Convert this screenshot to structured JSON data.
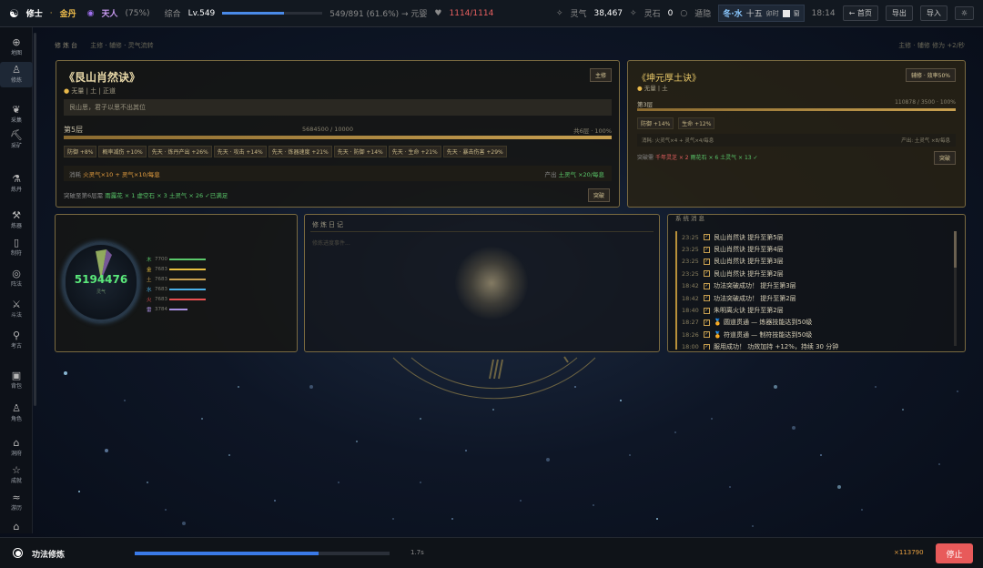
{
  "topbar": {
    "logo_icon": "yin-yang-icon",
    "profession": "修士",
    "realm": "金丹",
    "rank": "天人",
    "rank_pct": "(75%)",
    "level_label": "综合",
    "level": "Lv.549",
    "exp_text": "549/891 (61.6%) → 元婴",
    "exp_fraction": 0.616,
    "hp_icon": "heart-icon",
    "hp": "1114/1114",
    "spirit_qi_label": "灵气",
    "spirit_qi": "38,467",
    "spirit_stone_label": "灵石",
    "spirit_stone": "0",
    "travel_label": "遁隐",
    "season": "冬·水",
    "day": "十五",
    "hour": "卯时",
    "window_label": "窗",
    "time": "18:14",
    "home_btn": "← 首页",
    "export_btn": "导出",
    "import_btn": "导入",
    "settings_icon": "gear-icon"
  },
  "sidebar": [
    {
      "icon": "map-icon",
      "glyph": "⊕",
      "label": "地图"
    },
    {
      "icon": "cultivate-icon",
      "glyph": "♙",
      "label": "修炼"
    },
    {
      "icon": "gather-icon",
      "glyph": "❦",
      "label": "采集"
    },
    {
      "icon": "mine-icon",
      "glyph": "⛏",
      "label": "采矿"
    },
    {
      "icon": "alchemy-icon",
      "glyph": "⚗",
      "label": "炼丹"
    },
    {
      "icon": "forge-icon",
      "glyph": "⚒",
      "label": "炼器"
    },
    {
      "icon": "talisman-icon",
      "glyph": "▯",
      "label": "制符"
    },
    {
      "icon": "formation-icon",
      "glyph": "◎",
      "label": "阵法"
    },
    {
      "icon": "arena-icon",
      "glyph": "⚔",
      "label": "斗法"
    },
    {
      "icon": "explore-icon",
      "glyph": "⚲",
      "label": "考古"
    },
    {
      "icon": "bag-icon",
      "glyph": "▣",
      "label": "背包"
    },
    {
      "icon": "character-icon",
      "glyph": "♙",
      "label": "角色"
    },
    {
      "icon": "cave-icon",
      "glyph": "⌂",
      "label": "洞府"
    },
    {
      "icon": "achievement-icon",
      "glyph": "☆",
      "label": "成就"
    },
    {
      "icon": "journey-icon",
      "glyph": "≈",
      "label": "游历"
    },
    {
      "icon": "sect-icon",
      "glyph": "⌂",
      "label": ""
    }
  ],
  "header": {
    "title": "修炼台",
    "tabs": [
      "主修",
      "辅修",
      "灵气流转"
    ],
    "right_text": "主修 · 辅修 修为 +2/秒"
  },
  "main_method": {
    "title": "《艮山肖然诀》",
    "badge": "主修",
    "tags": [
      "无量",
      "土",
      "正道"
    ],
    "quote": "艮山思，君子以思不出其位",
    "layer": "第5层",
    "progress_text": "5684500 / 10000",
    "total_layers": "共6层 · 100%",
    "effects": [
      "防御 +8%",
      "概率减伤 +10%",
      "先天 · 炼丹产出 +26%",
      "先天 · 攻击 +14%",
      "先天 · 炼器速度 +21%",
      "先天 · 防御 +14%",
      "先天 · 生命 +21%",
      "先天 · 暴击伤害 +29%"
    ],
    "consume_label": "消耗",
    "consume_value": "火灵气×10 + 灵气×10/每息",
    "output_label": "产出",
    "output_value": "土灵气 ×20/每息",
    "break_label": "突破至第6层需",
    "break_items": [
      "雨露花 × 1",
      "虚空石 × 3",
      "土灵气 × 26"
    ],
    "break_status": "✓已满足",
    "break_btn": "突破"
  },
  "aux_method": {
    "title": "《坤元厚土诀》",
    "badge": "辅修 · 效率50%",
    "tags": [
      "无量",
      "土"
    ],
    "layer": "第3层",
    "progress_text": "110878 / 3500 · 100%",
    "effects": [
      "防御 +14%",
      "生命 +12%"
    ],
    "consume_text": "消耗: 火灵气×4 + 灵气×4/每息",
    "output_text": "产出: 土灵气 ×8/每息",
    "break_label": "突破需",
    "break_items": [
      "千年灵芝 × 2",
      "雨花石 × 6",
      "土灵气 × 13"
    ],
    "break_status": "✓",
    "break_btn": "突破"
  },
  "qi_panel": {
    "total": "5194476",
    "total_label": "灵气",
    "elements": [
      {
        "label": "木",
        "value": "7700",
        "color": "#5ac86a"
      },
      {
        "label": "金",
        "value": "7683",
        "color": "#e8c040"
      },
      {
        "label": "土",
        "value": "7683",
        "color": "#c8a050"
      },
      {
        "label": "水",
        "value": "7683",
        "color": "#4ab0e8"
      },
      {
        "label": "火",
        "value": "7683",
        "color": "#e85050"
      },
      {
        "label": "雷",
        "value": "3784",
        "color": "#a890e0"
      }
    ]
  },
  "journal": {
    "title": "修炼日记",
    "placeholder": "修炼进度事件..."
  },
  "log": {
    "title": "系统消息",
    "rows": [
      {
        "time": "23:25",
        "text": "艮山肖然诀 提升至第5层"
      },
      {
        "time": "23:25",
        "text": "艮山肖然诀 提升至第4层"
      },
      {
        "time": "23:25",
        "text": "艮山肖然诀 提升至第3层"
      },
      {
        "time": "23:25",
        "text": "艮山肖然诀 提升至第2层"
      },
      {
        "time": "18:42",
        "text": "功法突破成功！ 提升至第3层"
      },
      {
        "time": "18:42",
        "text": "功法突破成功！ 提升至第2层"
      },
      {
        "time": "18:40",
        "text": "朱明离火诀 提升至第2层"
      },
      {
        "time": "18:27",
        "text": "🏅 圆道贯通 — 炼器技能达到50级"
      },
      {
        "time": "18:26",
        "text": "🏅 符道贯通 — 制符技能达到50级"
      },
      {
        "time": "18:00",
        "text": "服用成功！ 功效加持 +12%，持续 30 分钟"
      }
    ]
  },
  "bottombar": {
    "icon": "record-icon",
    "activity": "功法修炼",
    "progress_fraction": 0.72,
    "speed": "1.7s",
    "gain": "×113790",
    "stop_btn": "停止"
  }
}
